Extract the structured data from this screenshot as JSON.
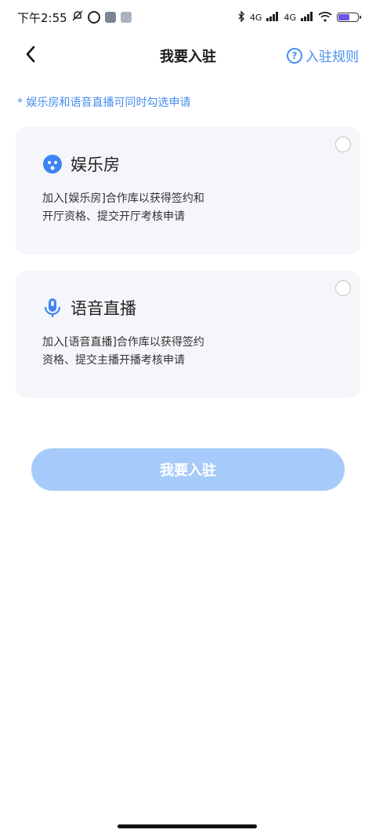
{
  "status_bar": {
    "time": "下午2:55",
    "network_label": "4G",
    "network_label_2": "4G",
    "accent_color": "#6b53e8"
  },
  "nav": {
    "back_icon": "chevron-left-icon",
    "title": "我要入驻",
    "rules_label": "入驻规则",
    "rules_icon": "help-circle-icon"
  },
  "tip": "* 娱乐房和语音直播可同时勾选申请",
  "options": [
    {
      "icon": "smiley-face-icon",
      "title": "娱乐房",
      "description_line1": "加入[娱乐房]合作库以获得签约和",
      "description_line2": "开厅资格、提交开厅考核申请",
      "selected": false
    },
    {
      "icon": "microphone-icon",
      "title": "语音直播",
      "description_line1": "加入[语音直播]合作库以获得签约",
      "description_line2": "资格、提交主播开播考核申请",
      "selected": false
    }
  ],
  "submit": {
    "label": "我要入驻",
    "color": "#a6cbfa"
  },
  "colors": {
    "primary": "#4a8df0",
    "card_bg": "#f5f6fa"
  }
}
